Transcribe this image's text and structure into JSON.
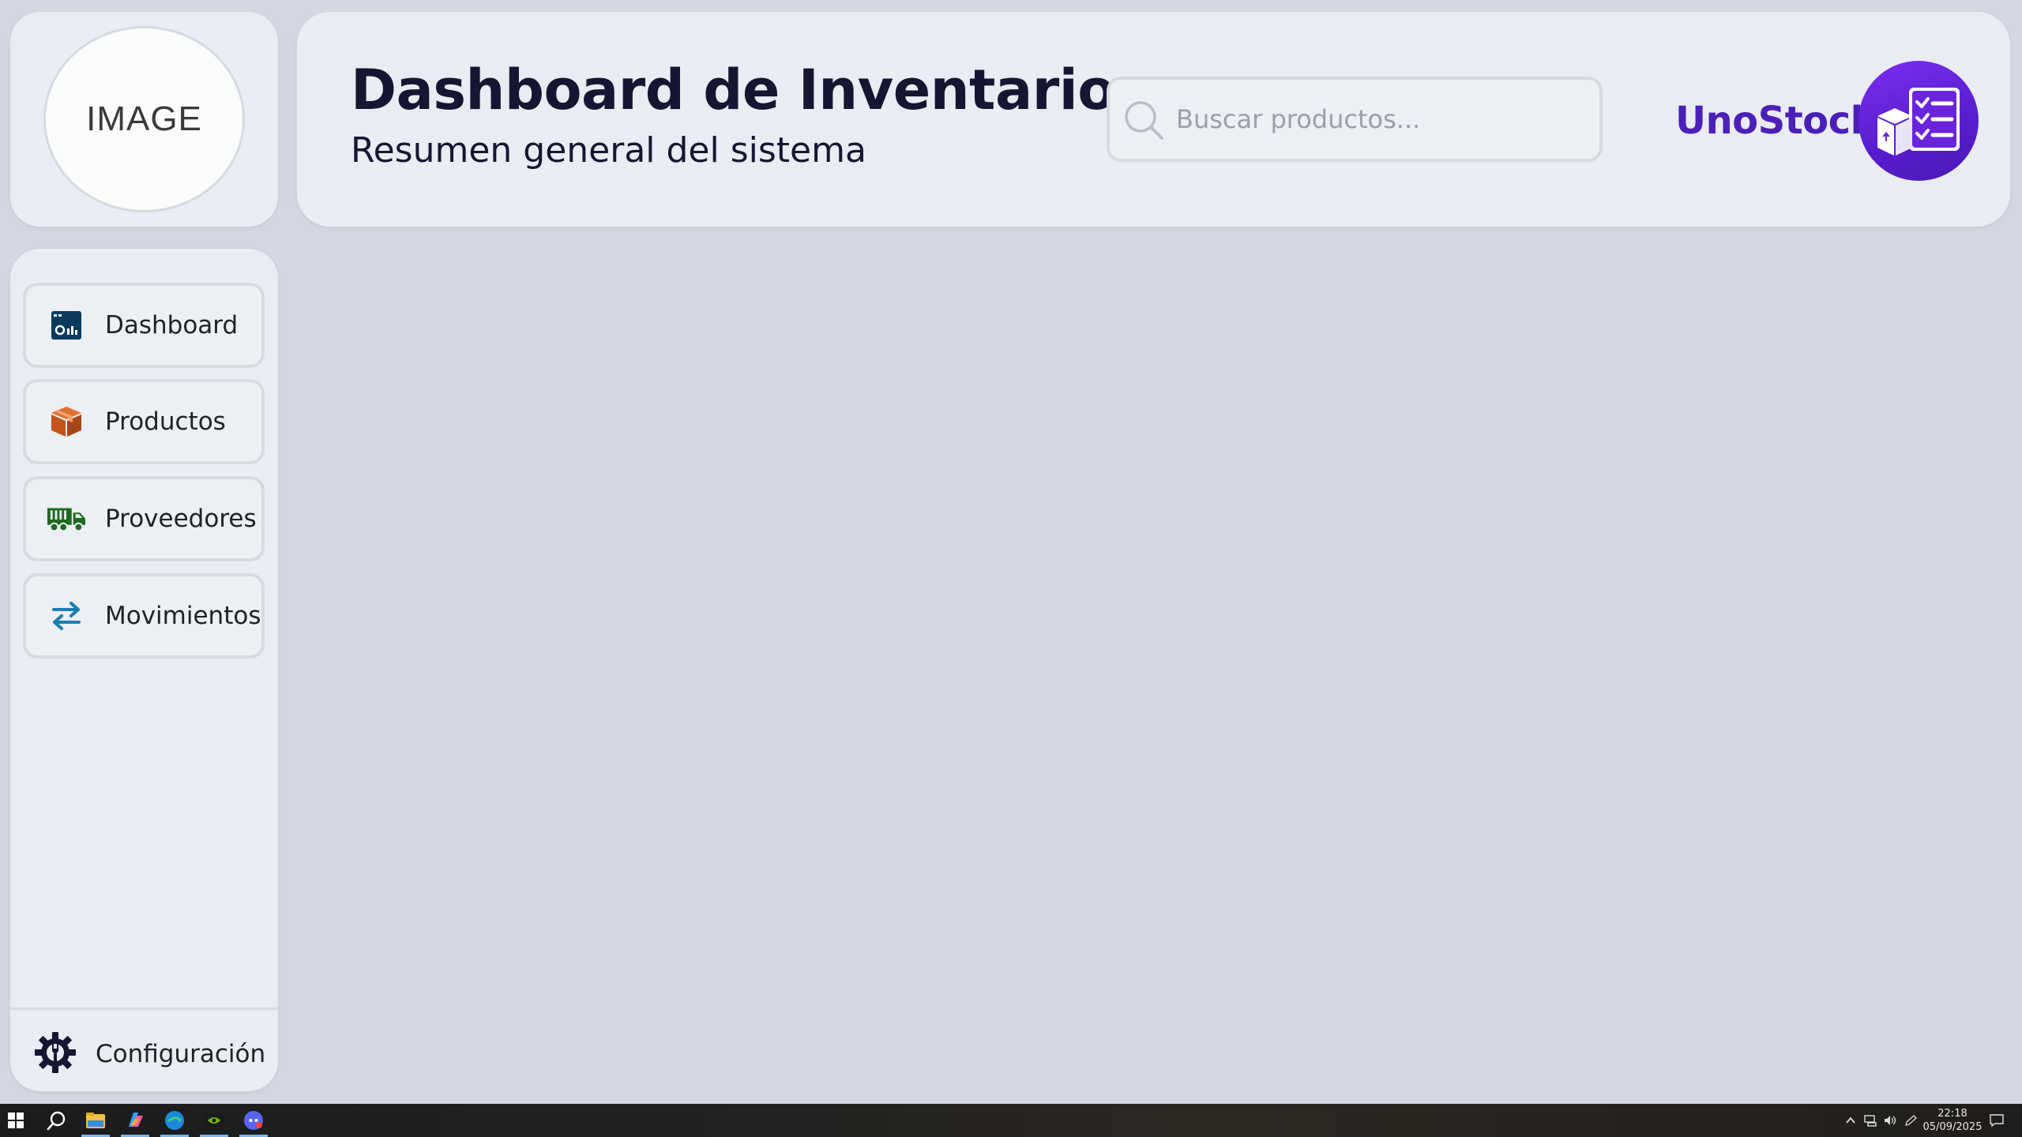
{
  "avatar": {
    "placeholder_text": "IMAGE"
  },
  "header": {
    "title": "Dashboard de Inventario",
    "subtitle": "Resumen general del sistema"
  },
  "search": {
    "placeholder": "Buscar productos...",
    "value": "",
    "icon": "search-icon"
  },
  "brand": {
    "name": "UnoStock",
    "logo_icon": "inventory-checklist-icon",
    "color": "#4b1fb8"
  },
  "sidebar": {
    "items": [
      {
        "label": "Dashboard",
        "icon": "dashboard-icon",
        "icon_color": "#0b3a5e"
      },
      {
        "label": "Productos",
        "icon": "box-icon",
        "icon_color": "#c2541c"
      },
      {
        "label": "Proveedores",
        "icon": "truck-icon",
        "icon_color": "#1e6a1e"
      },
      {
        "label": "Movimientos",
        "icon": "swap-arrows-icon",
        "icon_color": "#1a7fb0"
      }
    ],
    "settings": {
      "label": "Configuración",
      "icon": "gear-wrench-icon"
    }
  },
  "taskbar": {
    "apps": [
      "windows-start-icon",
      "search-icon",
      "file-explorer-icon",
      "copilot-icon",
      "edge-icon",
      "nvidia-icon",
      "discord-icon"
    ],
    "clock": {
      "time": "22:18",
      "date": "05/09/2025"
    }
  },
  "colors": {
    "background": "#d3d7e1",
    "card": "#e9ecf2",
    "title": "#161632"
  }
}
